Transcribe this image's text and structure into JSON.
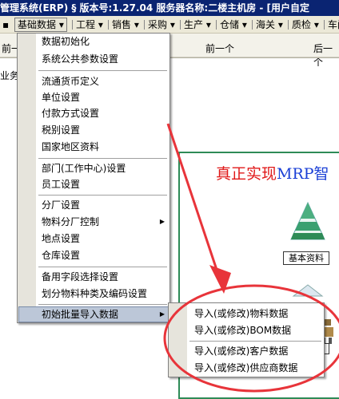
{
  "window": {
    "title": "管理系统(ERP) § 版本号:1.27.04  服务器名称:二楼主机房 - [用户自定"
  },
  "menubar": {
    "items": [
      {
        "label": "▪"
      },
      {
        "label": "基础数据 ▾"
      },
      {
        "label": "工程 ▾"
      },
      {
        "label": "销售 ▾"
      },
      {
        "label": "采购 ▾"
      },
      {
        "label": "生产 ▾"
      },
      {
        "label": "仓储 ▾"
      },
      {
        "label": "海关 ▾"
      },
      {
        "label": "质检 ▾"
      },
      {
        "label": "车间"
      }
    ]
  },
  "toolbar": {
    "left_label": "前一",
    "mid_label": "前一个",
    "right_label": "后一个",
    "sub_label": "业务"
  },
  "dropdown": {
    "items": [
      {
        "label": "数据初始化"
      },
      {
        "label": "系统公共参数设置"
      },
      {
        "label": "流通货币定义"
      },
      {
        "label": "单位设置"
      },
      {
        "label": "付款方式设置"
      },
      {
        "label": "税别设置"
      },
      {
        "label": "国家地区资料"
      },
      {
        "label": "部门(工作中心)设置"
      },
      {
        "label": "员工设置"
      },
      {
        "label": "分厂设置"
      },
      {
        "label": "物料分厂控制"
      },
      {
        "label": "地点设置"
      },
      {
        "label": "仓库设置"
      },
      {
        "label": "备用字段选择设置"
      },
      {
        "label": "划分物料种类及编码设置"
      },
      {
        "label": "初始批量导入数据"
      }
    ]
  },
  "submenu": {
    "items": [
      {
        "label": "导入(或修改)物料数据"
      },
      {
        "label": "导入(或修改)BOM数据"
      },
      {
        "label": "导入(或修改)客户数据"
      },
      {
        "label": "导入(或修改)供应商数据"
      }
    ]
  },
  "background": {
    "banner_red": "真正实现",
    "banner_blue": "MRP智",
    "basic_button": "基本资料"
  },
  "colors": {
    "titlebar": "#0a2472",
    "menubar": "#ece9d8",
    "highlight": "#bcc7d8",
    "annotation": "#e8343a",
    "banner_red": "#e01818",
    "banner_blue": "#1a3fd6"
  }
}
